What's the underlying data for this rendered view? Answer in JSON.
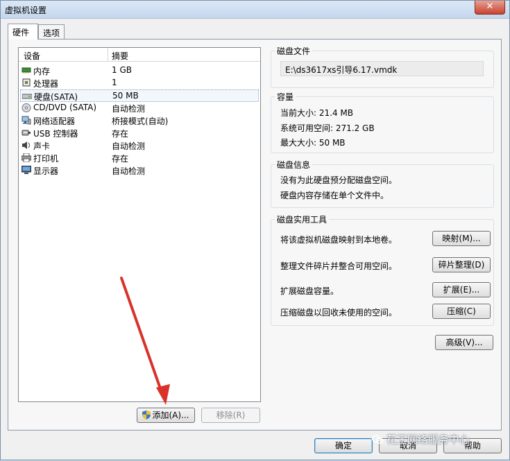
{
  "window": {
    "title": "虚拟机设置",
    "close_label": "✕"
  },
  "tabs": [
    {
      "label": "硬件",
      "active": true
    },
    {
      "label": "选项",
      "active": false
    }
  ],
  "device_list": {
    "headers": {
      "device": "设备",
      "summary": "摘要"
    },
    "rows": [
      {
        "icon": "memory-icon",
        "name": "内存",
        "summary": "1 GB"
      },
      {
        "icon": "processor-icon",
        "name": "处理器",
        "summary": "1"
      },
      {
        "icon": "hard-disk-icon",
        "name": "硬盘(SATA)",
        "summary": "50 MB",
        "selected": true
      },
      {
        "icon": "cd-dvd-icon",
        "name": "CD/DVD (SATA)",
        "summary": "自动检测"
      },
      {
        "icon": "network-adapter-icon",
        "name": "网络适配器",
        "summary": "桥接模式(自动)"
      },
      {
        "icon": "usb-icon",
        "name": "USB 控制器",
        "summary": "存在"
      },
      {
        "icon": "sound-card-icon",
        "name": "声卡",
        "summary": "自动检测"
      },
      {
        "icon": "printer-icon",
        "name": "打印机",
        "summary": "存在"
      },
      {
        "icon": "display-icon",
        "name": "显示器",
        "summary": "自动检测"
      }
    ],
    "add_button": "添加(A)...",
    "remove_button": "移除(R)"
  },
  "disk_file": {
    "title": "磁盘文件",
    "path": "E:\\ds3617xs引导6.17.vmdk"
  },
  "capacity": {
    "title": "容量",
    "current_size": "当前大小: 21.4 MB",
    "system_free": "系统可用空间: 271.2 GB",
    "max_size": "最大大小: 50 MB"
  },
  "disk_info": {
    "title": "磁盘信息",
    "line1": "没有为此硬盘预分配磁盘空间。",
    "line2": "硬盘内容存储在单个文件中。"
  },
  "disk_utilities": {
    "title": "磁盘实用工具",
    "map_text": "将该虚拟机磁盘映射到本地卷。",
    "map_button": "映射(M)...",
    "defrag_text": "整理文件碎片并整合可用空间。",
    "defrag_button": "碎片整理(D)",
    "expand_text": "扩展磁盘容量。",
    "expand_button": "扩展(E)...",
    "compact_text": "压缩磁盘以回收未使用的空间。",
    "compact_button": "压缩(C)"
  },
  "advanced_button": "高级(V)...",
  "footer": {
    "ok": "确定",
    "cancel": "取消",
    "help": "帮助"
  },
  "watermark": "花王网络服务中心",
  "colors": {
    "arrow": "#d9322b",
    "selection_border": "#7da2ce"
  }
}
